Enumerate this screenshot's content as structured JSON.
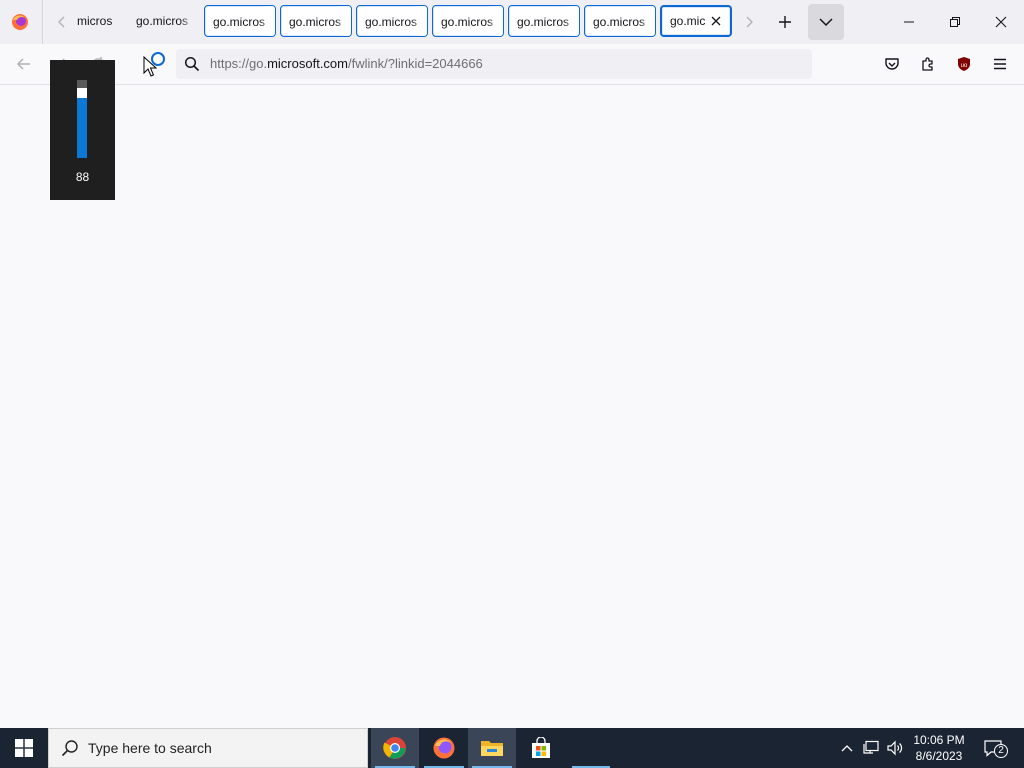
{
  "browser": {
    "tabs": [
      {
        "label": "micros",
        "style": "plain"
      },
      {
        "label": "go.micros",
        "style": "plain"
      },
      {
        "label": "go.micros",
        "style": "boxed"
      },
      {
        "label": "go.micros",
        "style": "boxed"
      },
      {
        "label": "go.micros",
        "style": "boxed"
      },
      {
        "label": "go.micros",
        "style": "boxed"
      },
      {
        "label": "go.micros",
        "style": "boxed"
      },
      {
        "label": "go.micros",
        "style": "boxed"
      },
      {
        "label": "go.mic",
        "style": "active"
      }
    ],
    "url": {
      "prefix": "https://go.",
      "host": "microsoft.com",
      "path": "/fwlink/?linkid=2044666"
    },
    "accent_color": "#0b68d4"
  },
  "volume_osd": {
    "value": "88",
    "level": 0.88
  },
  "taskbar": {
    "search_placeholder": "Type here to search",
    "apps": [
      "chrome-icon",
      "firefox-icon",
      "file-explorer-icon",
      "store-icon"
    ],
    "clock": {
      "time": "10:06 PM",
      "date": "8/6/2023"
    },
    "notification_count": "2"
  }
}
